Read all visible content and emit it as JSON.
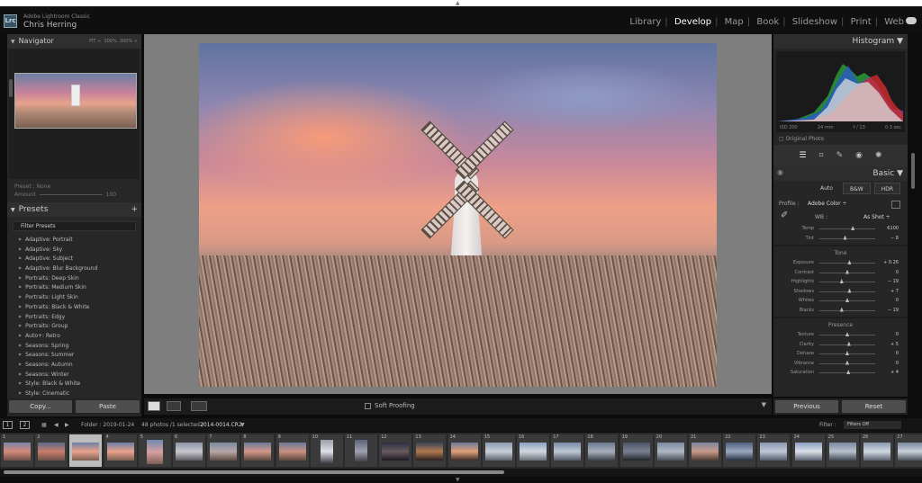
{
  "app": {
    "logo": "Lrc",
    "name": "Adobe Lightroom Classic",
    "user": "Chris Herring"
  },
  "modules": [
    {
      "label": "Library",
      "active": false
    },
    {
      "label": "Develop",
      "active": true
    },
    {
      "label": "Map",
      "active": false
    },
    {
      "label": "Book",
      "active": false
    },
    {
      "label": "Slideshow",
      "active": false
    },
    {
      "label": "Print",
      "active": false
    },
    {
      "label": "Web",
      "active": false
    }
  ],
  "navigator": {
    "title": "Navigator",
    "fit": "FIT ÷",
    "z100": "100%",
    "z300": "300% ÷",
    "preset_label": "Preset : None",
    "amount_label": "Amount",
    "amount_value": "100"
  },
  "presets": {
    "title": "Presets",
    "filter_placeholder": "Filter Presets",
    "items": [
      "Adaptive: Portrait",
      "Adaptive: Sky",
      "Adaptive: Subject",
      "Adaptive: Blur Background",
      "Portraits: Deep Skin",
      "Portraits: Medium Skin",
      "Portraits: Light Skin",
      "Portraits: Black & White",
      "Portraits: Edgy",
      "Portraits: Group",
      "Auto+: Retro",
      "Seasons: Spring",
      "Seasons: Summer",
      "Seasons: Autumn",
      "Seasons: Winter",
      "Style: Black & White",
      "Style: Cinematic"
    ]
  },
  "left_buttons": {
    "copy": "Copy...",
    "paste": "Paste"
  },
  "toolbar": {
    "soft_proofing": "Soft Proofing",
    "chevron": "▼"
  },
  "histogram": {
    "title": "Histogram",
    "iso": "ISO 200",
    "focal": "24 mm",
    "aperture": "f / 13",
    "shutter": "0.3 sec",
    "original_photo": "Original Photo"
  },
  "basic": {
    "title": "Basic",
    "auto": "Auto",
    "bw": "B&W",
    "hdr": "HDR",
    "profile_label": "Profile :",
    "profile_value": "Adobe Color ÷",
    "wb_label": "WB :",
    "wb_value": "As Shot ÷",
    "wb_sliders": [
      {
        "label": "Temp",
        "value": "6100",
        "pos": 0.6
      },
      {
        "label": "Tint",
        "value": "− 8",
        "pos": 0.46
      }
    ],
    "tone_title": "Tone",
    "tone_sliders": [
      {
        "label": "Exposure",
        "value": "+ 0.26",
        "pos": 0.54
      },
      {
        "label": "Contrast",
        "value": "0",
        "pos": 0.5
      },
      {
        "label": "Highlights",
        "value": "− 19",
        "pos": 0.4
      },
      {
        "label": "Shadows",
        "value": "+ 7",
        "pos": 0.54
      },
      {
        "label": "Whites",
        "value": "0",
        "pos": 0.5
      },
      {
        "label": "Blacks",
        "value": "− 19",
        "pos": 0.4
      }
    ],
    "presence_title": "Presence",
    "presence_sliders": [
      {
        "label": "Texture",
        "value": "0",
        "pos": 0.5
      },
      {
        "label": "Clarity",
        "value": "+ 5",
        "pos": 0.53
      },
      {
        "label": "Dehaze",
        "value": "0",
        "pos": 0.5
      },
      {
        "label": "Vibrance",
        "value": "0",
        "pos": 0.5
      },
      {
        "label": "Saturation",
        "value": "+ 4",
        "pos": 0.52
      }
    ]
  },
  "right_buttons": {
    "previous": "Previous",
    "reset": "Reset"
  },
  "filmbar": {
    "page1": "1",
    "page2": "2",
    "folder": "Folder : 2019-01-24",
    "count": "48 photos /1 selected /",
    "filename": "2014-0014.CR2",
    "filename_arrow": "▼",
    "filter_label": "Filter :",
    "filter_value": "Filters Off"
  },
  "filmstrip": {
    "numbers": [
      "1",
      "2",
      "3",
      "4",
      "5",
      "6",
      "7",
      "8",
      "9",
      "10",
      "11",
      "12",
      "13",
      "14",
      "15",
      "16",
      "17",
      "18",
      "19",
      "20",
      "21",
      "22",
      "23",
      "24",
      "25",
      "26",
      "27"
    ],
    "selected": 2
  },
  "colors": {
    "accent": "#ffffff",
    "panel": "#262626"
  }
}
